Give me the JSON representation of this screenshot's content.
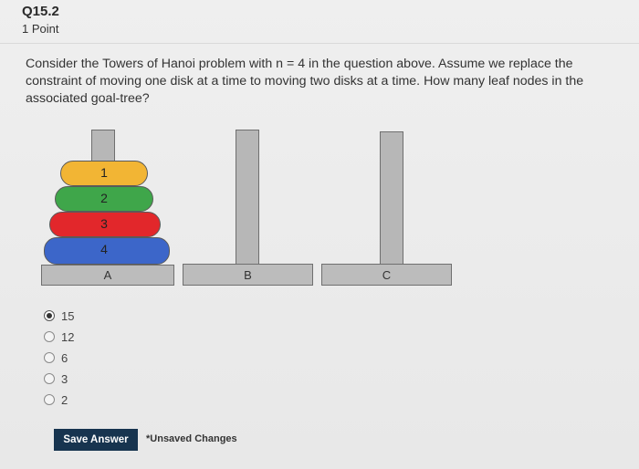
{
  "question": {
    "number": "Q15.2",
    "points": "1 Point",
    "prompt": "Consider the Towers of Hanoi problem with n = 4 in the question above. Assume we replace the constraint of moving one disk at a time to moving two disks at a time. How many leaf nodes in the associated goal-tree?"
  },
  "figure": {
    "pegs": [
      "A",
      "B",
      "C"
    ],
    "disks": [
      {
        "label": "1",
        "color": "#f2b534"
      },
      {
        "label": "2",
        "color": "#3fa64a"
      },
      {
        "label": "3",
        "color": "#e2272b"
      },
      {
        "label": "4",
        "color": "#3c66c9"
      }
    ],
    "peg_color": "#b7b7b7"
  },
  "options": [
    {
      "label": "15",
      "selected": true
    },
    {
      "label": "12",
      "selected": false
    },
    {
      "label": "6",
      "selected": false
    },
    {
      "label": "3",
      "selected": false
    },
    {
      "label": "2",
      "selected": false
    }
  ],
  "footer": {
    "save_label": "Save Answer",
    "status": "*Unsaved Changes"
  },
  "colors": {
    "button_bg": "#17344f",
    "page_bg": "#ececec"
  }
}
